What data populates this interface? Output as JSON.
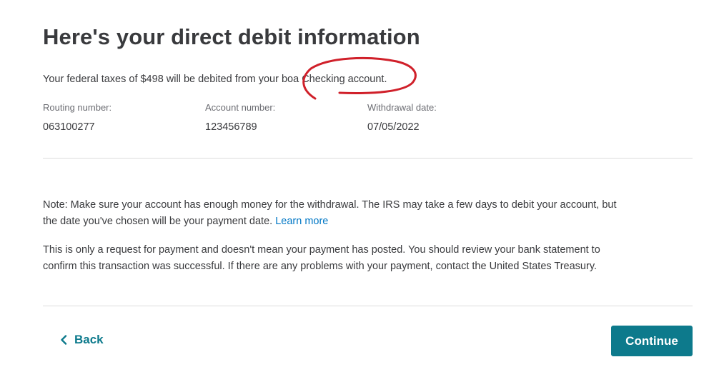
{
  "heading": "Here's your direct debit information",
  "summary": {
    "prefix": "Your federal taxes of $498 will be debited from your ",
    "bank": "boa",
    "account_type": " Checking account."
  },
  "fields": {
    "routing": {
      "label": "Routing number:",
      "value": "063100277"
    },
    "account": {
      "label": "Account number:",
      "value": "123456789"
    },
    "withdrawal": {
      "label": "Withdrawal date:",
      "value": "07/05/2022"
    }
  },
  "note": {
    "text": "Note: Make sure your account has enough money for the withdrawal. The IRS may take a few days to debit your account, but the date you've chosen will be your payment date. ",
    "link": "Learn more"
  },
  "disclaimer": "This is only a request for payment and doesn't mean your payment has posted. You should review your bank statement to confirm this transaction was successful. If there are any problems with your payment, contact the United States Treasury.",
  "actions": {
    "back_label": "Back",
    "continue_label": "Continue"
  },
  "colors": {
    "accent": "#0d7a8c",
    "link": "#0077c5",
    "annotation": "#d0202a"
  },
  "icons": {
    "back": "chevron-left-icon"
  }
}
